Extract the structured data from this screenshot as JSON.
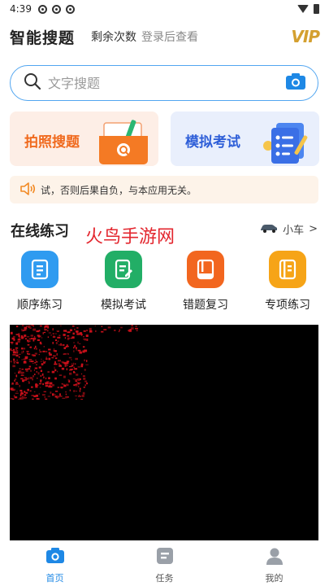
{
  "status_bar": {
    "time": "4:39"
  },
  "header": {
    "title": "智能搜题",
    "remaining_label": "剩余次数",
    "login_link": "登录后查看",
    "vip_label": "VIP"
  },
  "search": {
    "placeholder": "文字搜题"
  },
  "feature_cards": [
    {
      "label": "拍照搜题"
    },
    {
      "label": "模拟考试"
    }
  ],
  "notice": {
    "text": "试，否则后果自负，与本应用无关。"
  },
  "section": {
    "title": "在线练习",
    "watermark": "火鸟手游网",
    "car_type": "小车",
    "car_chevron": ">"
  },
  "practice_items": [
    {
      "label": "顺序练习",
      "color": "#2f9bf0"
    },
    {
      "label": "模拟考试",
      "color": "#22ae66"
    },
    {
      "label": "错题复习",
      "color": "#f2661f"
    },
    {
      "label": "专项练习",
      "color": "#f6a417"
    }
  ],
  "bottom_nav": [
    {
      "label": "首页",
      "active": true
    },
    {
      "label": "任务",
      "active": false
    },
    {
      "label": "我的",
      "active": false
    }
  ],
  "colors": {
    "accent": "#1e88e5",
    "photo_card": "#f06a1e",
    "exam_card": "#2f5fd8",
    "watermark": "#e3262e"
  }
}
